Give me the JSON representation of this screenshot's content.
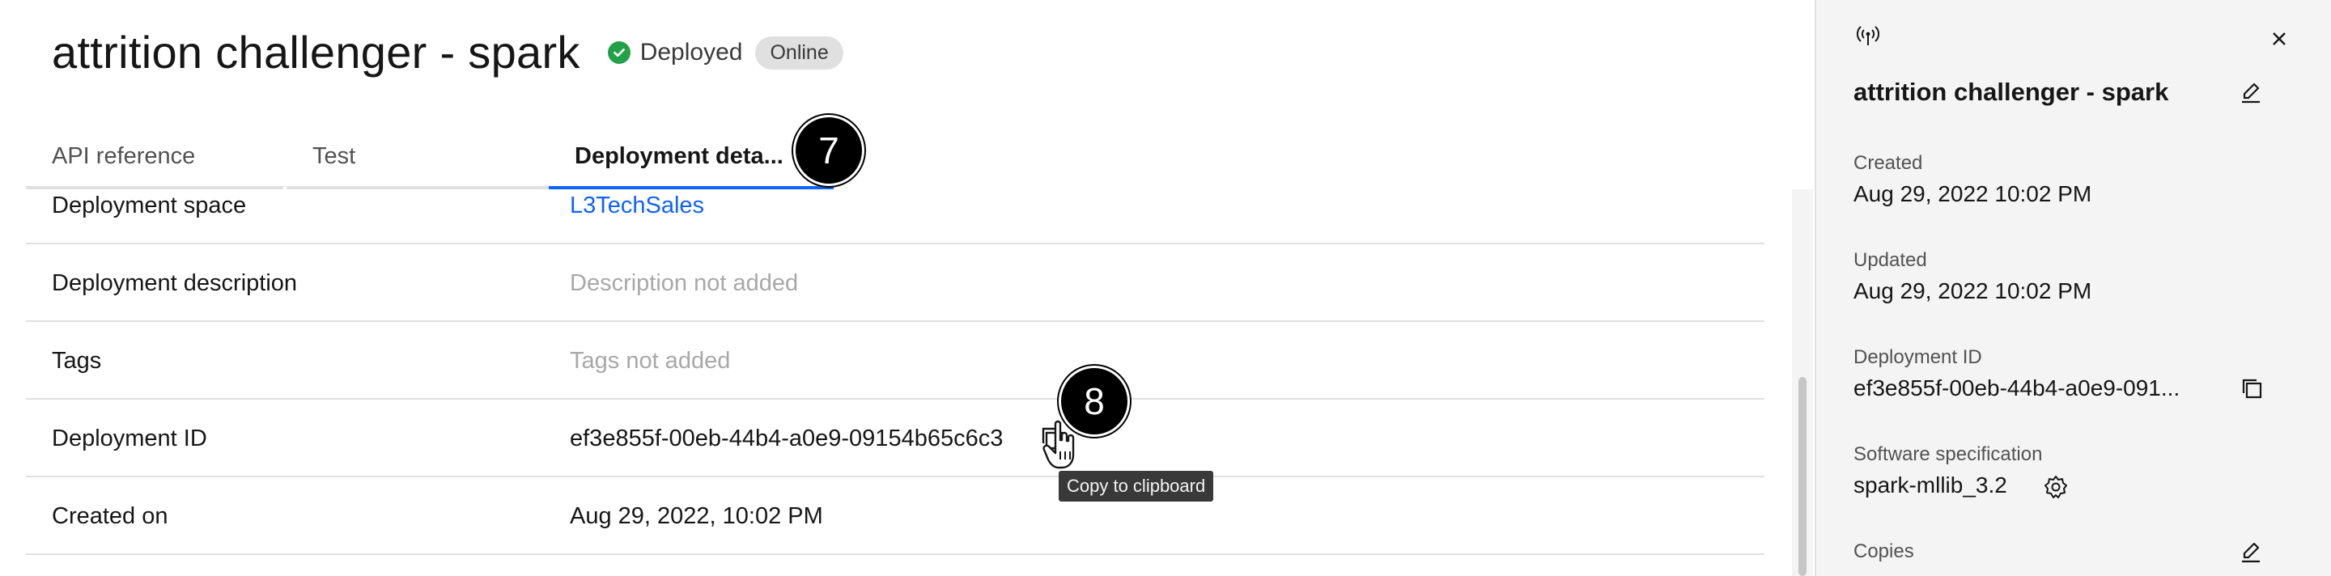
{
  "header": {
    "title": "attrition challenger - spark",
    "status_label": "Deployed",
    "online_badge": "Online"
  },
  "tabs": [
    {
      "label": "API reference"
    },
    {
      "label": "Test"
    },
    {
      "label": "Deployment deta..."
    }
  ],
  "step_markers": {
    "tabs": "7",
    "copy": "8"
  },
  "details": {
    "rows": [
      {
        "label": "Deployment space",
        "value": "L3TechSales"
      },
      {
        "label": "Deployment description",
        "value": "Description not added"
      },
      {
        "label": "Tags",
        "value": "Tags not added"
      },
      {
        "label": "Deployment ID",
        "value": "ef3e855f-00eb-44b4-a0e9-09154b65c6c3"
      },
      {
        "label": "Created on",
        "value": "Aug 29, 2022, 10:02 PM"
      }
    ],
    "tooltip": "Copy to clipboard"
  },
  "panel": {
    "title": "attrition challenger - spark",
    "created_label": "Created",
    "created_value": "Aug 29, 2022 10:02 PM",
    "updated_label": "Updated",
    "updated_value": "Aug 29, 2022 10:02 PM",
    "deployment_id_label": "Deployment ID",
    "deployment_id_value": "ef3e855f-00eb-44b4-a0e9-091...",
    "software_spec_label": "Software specification",
    "software_spec_value": "spark-mllib_3.2",
    "copies_label": "Copies"
  },
  "colors": {
    "accent": "#0f62fe",
    "success": "#24a148",
    "panel_bg": "#f4f4f4"
  },
  "icons": [
    "checkmark-icon",
    "broadcast-icon",
    "close-icon",
    "edit-icon",
    "copy-icon",
    "gear-icon",
    "hand-cursor-icon"
  ]
}
